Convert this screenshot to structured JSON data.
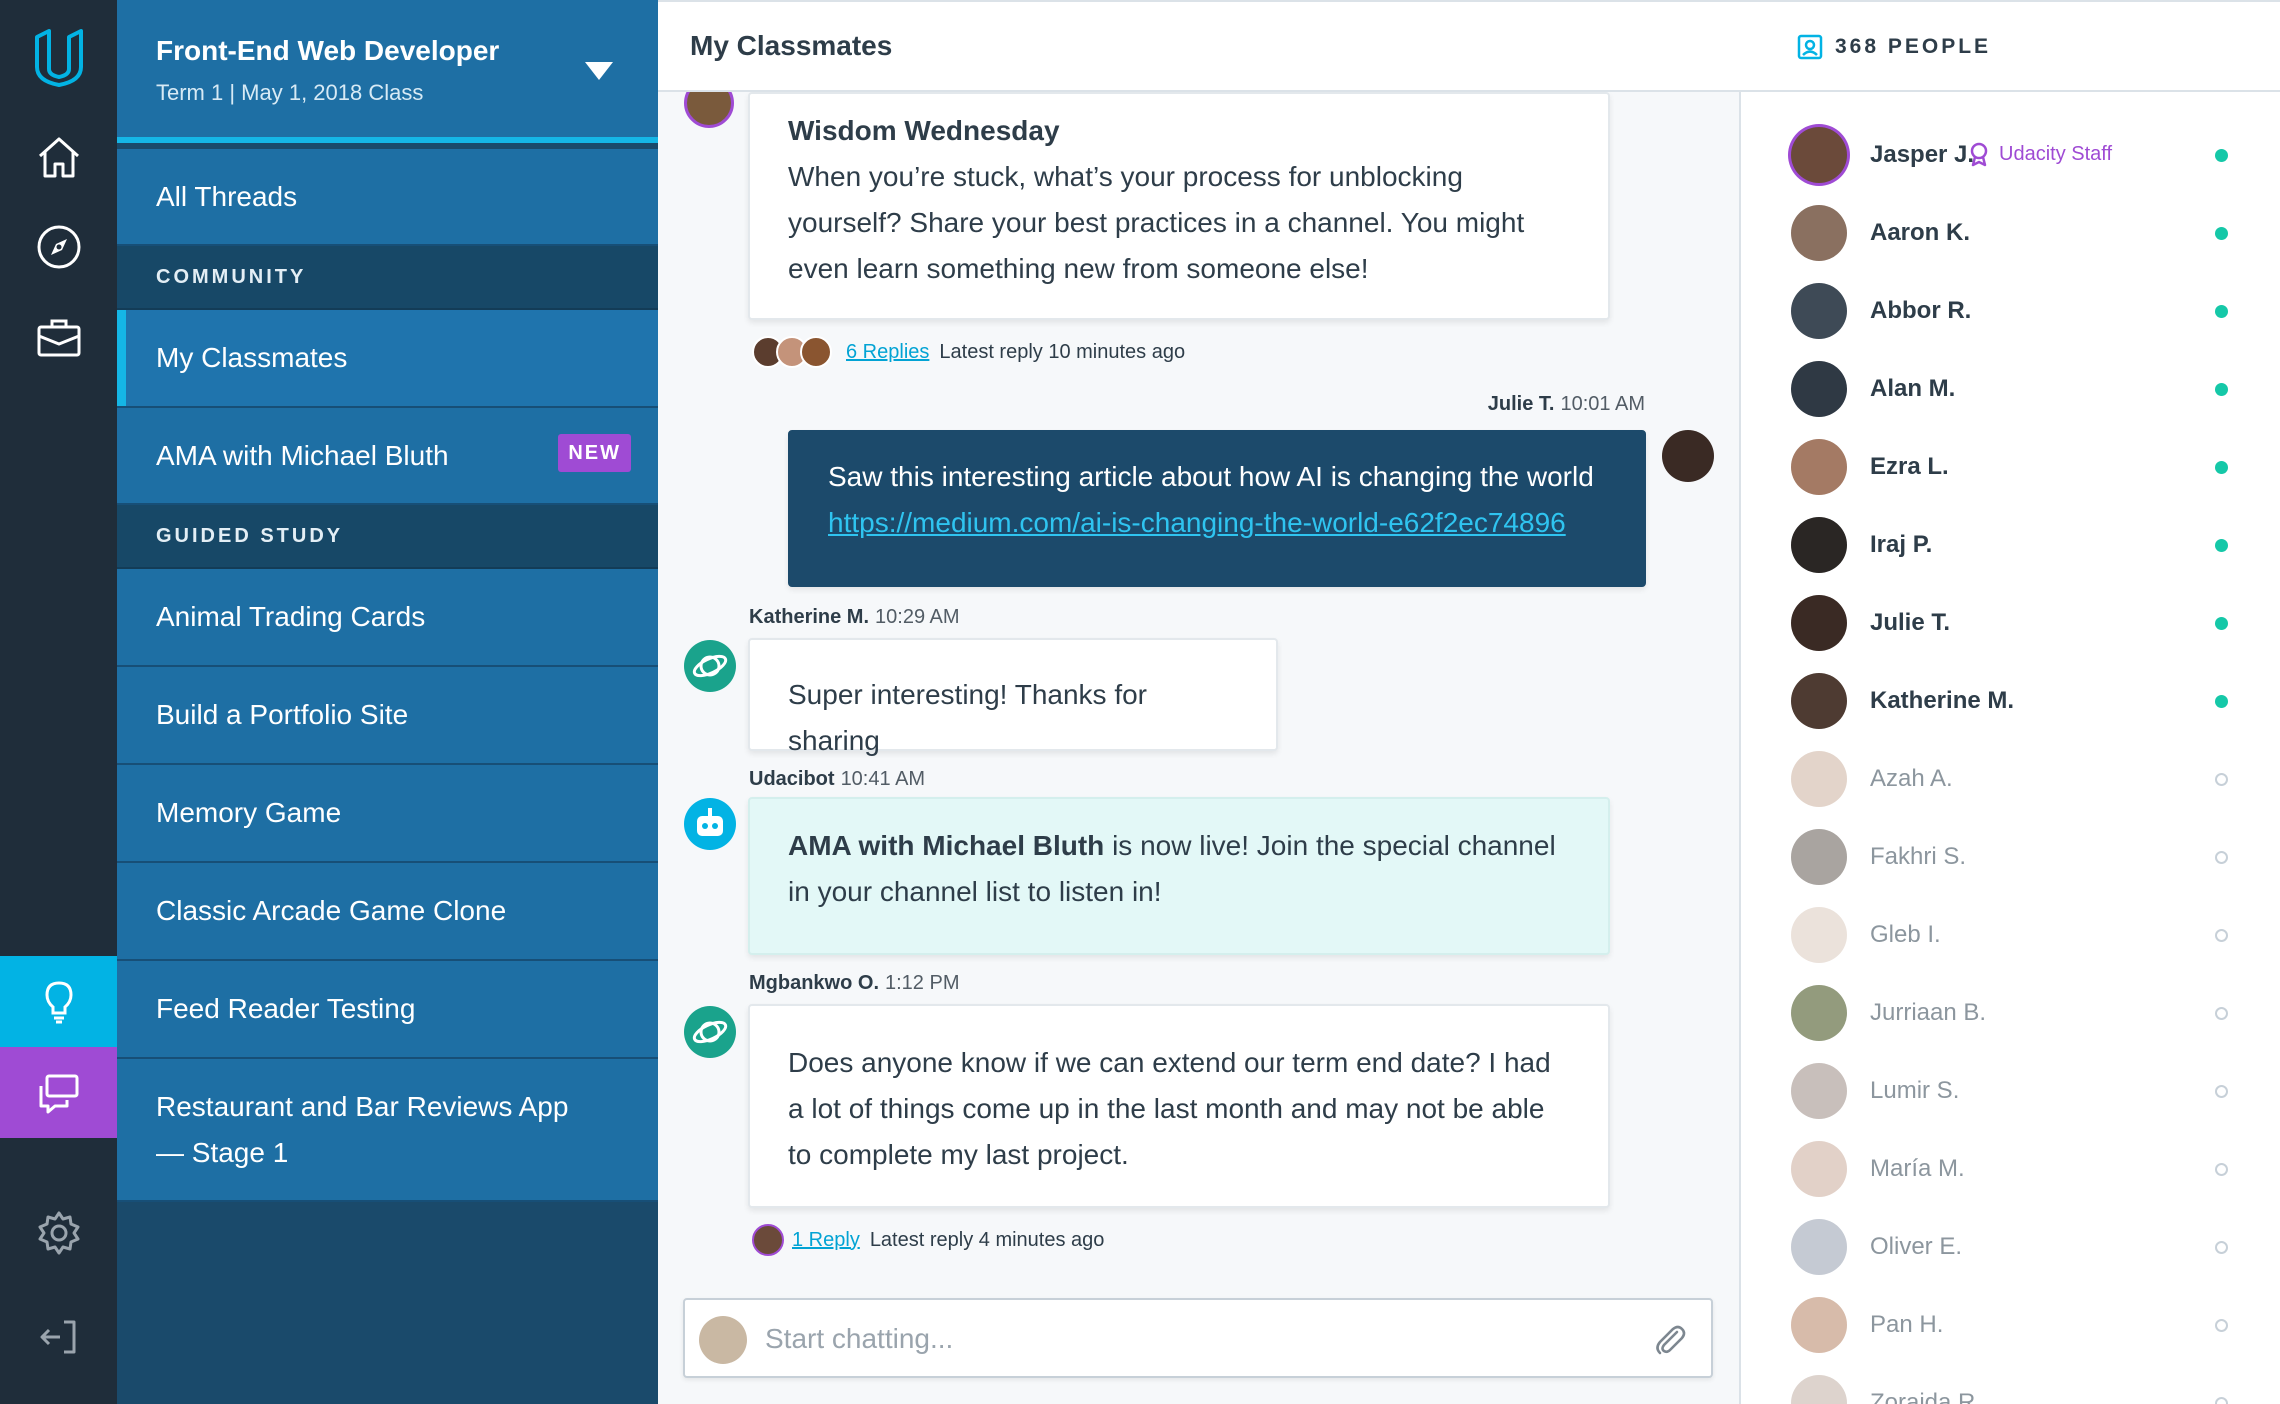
{
  "sidebar": {
    "course_title": "Front-End Web Developer",
    "course_subtitle": "Term 1  |  May 1, 2018 Class",
    "all_threads": "All Threads",
    "community_heading": "COMMUNITY",
    "my_classmates": "My Classmates",
    "ama": "AMA with Michael Bluth",
    "new_badge": "NEW",
    "guided_heading": "GUIDED STUDY",
    "items": [
      "Animal Trading Cards",
      "Build a Portfolio Site",
      "Memory Game",
      "Classic Arcade Game Clone",
      "Feed Reader Testing"
    ],
    "last_item_line1": "Restaurant and Bar Reviews App",
    "last_item_line2": "— Stage 1"
  },
  "main": {
    "title": "My Classmates",
    "messages": [
      {
        "title": "Wisdom Wednesday",
        "body": "When you’re stuck, what’s your process for unblocking yourself? Share your best practices in a channel. You might even learn something new from someone else!",
        "replies_link": "6 Replies",
        "replies_text": "Latest reply 10 minutes ago"
      },
      {
        "author": "Julie T.",
        "time": "10:01 AM",
        "body": "Saw this interesting article about how AI is changing the world",
        "link": "https://medium.com/ai-is-changing-the-world-e62f2ec74896"
      },
      {
        "author": "Katherine M.",
        "time": "10:29 AM",
        "body": "Super interesting! Thanks for sharing"
      },
      {
        "author": "Udacibot",
        "time": "10:41 AM",
        "body_bold": "AMA with Michael Bluth",
        "body": " is now live! Join the special channel in your channel list to listen in!"
      },
      {
        "author": "Mgbankwo O.",
        "time": "1:12 PM",
        "body": "Does anyone know if we can extend our term end date? I had a lot of things come up in the last month and may not be able to complete my last project.",
        "replies_link": "1 Reply",
        "replies_text": "Latest reply 4 minutes ago"
      }
    ],
    "composer_placeholder": "Start chatting..."
  },
  "people": {
    "count_label": "368 PEOPLE",
    "staff_label": "Udacity Staff",
    "list": [
      {
        "name": "Jasper J.",
        "online": true,
        "color": "#6b4a3a"
      },
      {
        "name": "Aaron K.",
        "online": true,
        "color": "#8a7060"
      },
      {
        "name": "Abbor R.",
        "online": true,
        "color": "#3e4a56"
      },
      {
        "name": "Alan M.",
        "online": true,
        "color": "#2f3944"
      },
      {
        "name": "Ezra L.",
        "online": true,
        "color": "#a47a64"
      },
      {
        "name": "Iraj P.",
        "online": true,
        "color": "#2a2624"
      },
      {
        "name": "Julie T.",
        "online": true,
        "color": "#3a2a24"
      },
      {
        "name": "Katherine M.",
        "online": true,
        "color": "#4e3b32"
      },
      {
        "name": "Azah A.",
        "online": false,
        "color": "#d9c5b8"
      },
      {
        "name": "Fakhri S.",
        "online": false,
        "color": "#8c8580"
      },
      {
        "name": "Gleb I.",
        "online": false,
        "color": "#e4d8cf"
      },
      {
        "name": "Jurriaan B.",
        "online": false,
        "color": "#6f7a52"
      },
      {
        "name": "Lumir S.",
        "online": false,
        "color": "#b6aaa4"
      },
      {
        "name": "María M.",
        "online": false,
        "color": "#d8c2b6"
      },
      {
        "name": "Oliver E.",
        "online": false,
        "color": "#b1b8c4"
      },
      {
        "name": "Pan H.",
        "online": false,
        "color": "#caa48e"
      },
      {
        "name": "Zoraida R.",
        "online": false,
        "color": "#d2c4bc"
      }
    ]
  },
  "colors": {
    "accent_blue": "#02b3e4",
    "accent_purple": "#9f4bd4",
    "online_green": "#15c8a8",
    "sidebar_blue": "#1e6fa4",
    "rail_dark": "#1f2d3a"
  },
  "icons": [
    "udacity-logo-icon",
    "home-icon",
    "compass-icon",
    "briefcase-icon",
    "lightbulb-icon",
    "chat-icon",
    "gear-icon",
    "logout-icon",
    "people-icon",
    "paperclip-icon",
    "staff-ribbon-icon",
    "robot-icon",
    "planet-icon"
  ]
}
